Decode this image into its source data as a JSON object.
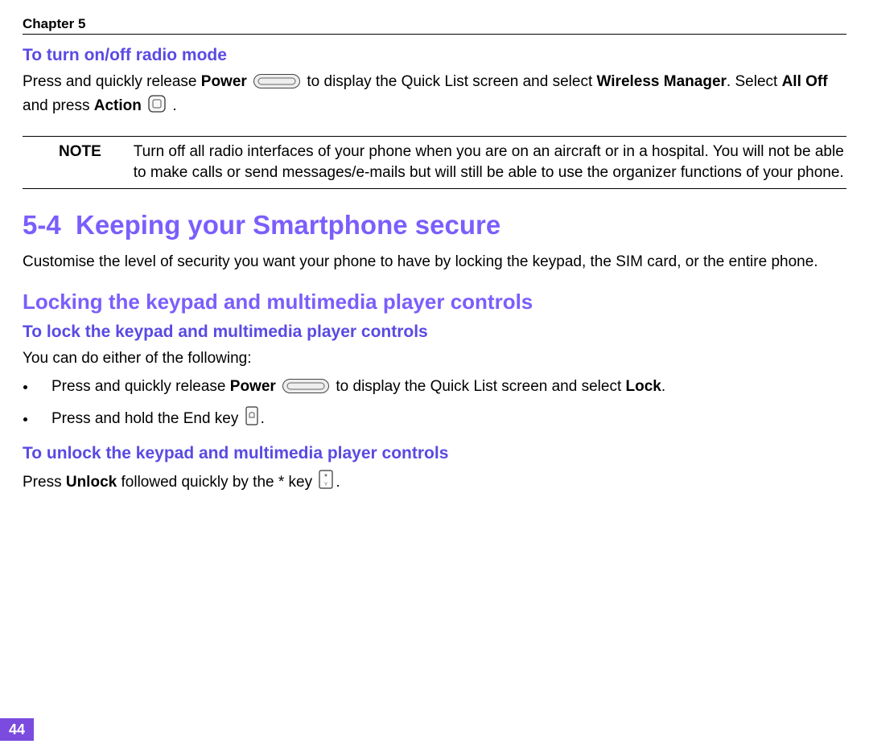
{
  "chapter_header": "Chapter 5",
  "radio_heading": "To turn on/off radio mode",
  "radio_p1_a": "Press and quickly release ",
  "radio_p1_b": "Power",
  "radio_p1_c": " to display the Quick List screen and select ",
  "radio_p1_d": "Wireless Manager",
  "radio_p1_e": ". Select ",
  "radio_p1_f": "All Off",
  "radio_p1_g": " and press ",
  "radio_p1_h": "Action",
  "radio_p1_i": " .",
  "note_label": "NOTE",
  "note_text": "Turn off all radio interfaces of your phone when you are on an aircraft or in a hospital. You will not be able to make calls or send messages/e-mails but will still be able to use the organizer functions of your phone.",
  "h1_num": "5-4",
  "h1_text": "Keeping your Smartphone secure",
  "h1_intro": "Customise the level of security you want your phone to have by locking the keypad, the SIM card, or the entire phone.",
  "h2_text": "Locking the keypad and multimedia player controls",
  "h3_lock": "To lock the keypad and multimedia player controls",
  "lock_intro": "You can do either of the following:",
  "bullet1_a": "Press and quickly release ",
  "bullet1_b": "Power",
  "bullet1_c": "  to display the Quick List screen and select ",
  "bullet1_d": "Lock",
  "bullet1_e": ".",
  "bullet2_a": "Press and hold the End key ",
  "bullet2_b": ".",
  "h3_unlock": "To unlock the keypad and multimedia player controls",
  "unlock_a": "Press ",
  "unlock_b": "Unlock",
  "unlock_c": "  followed quickly by the * key ",
  "unlock_d": ".",
  "page_number": "44",
  "icons": {
    "power": "power-button-icon",
    "action": "action-button-icon",
    "end": "end-key-icon",
    "star": "star-key-icon"
  }
}
